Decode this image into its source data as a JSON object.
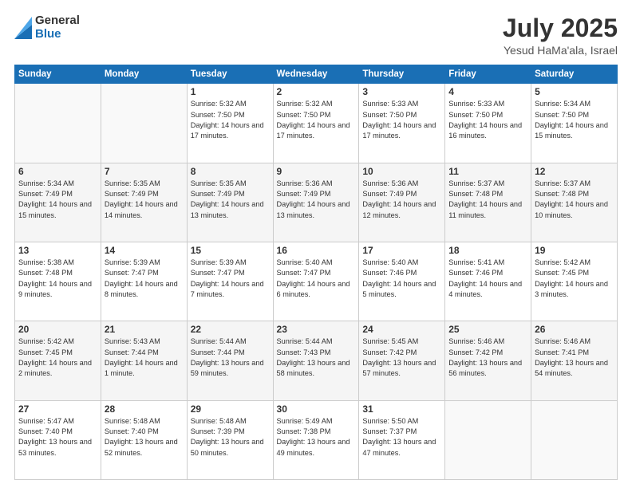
{
  "header": {
    "logo_general": "General",
    "logo_blue": "Blue",
    "title": "July 2025",
    "location": "Yesud HaMa'ala, Israel"
  },
  "weekdays": [
    "Sunday",
    "Monday",
    "Tuesday",
    "Wednesday",
    "Thursday",
    "Friday",
    "Saturday"
  ],
  "weeks": [
    [
      {
        "day": "",
        "sunrise": "",
        "sunset": "",
        "daylight": ""
      },
      {
        "day": "",
        "sunrise": "",
        "sunset": "",
        "daylight": ""
      },
      {
        "day": "1",
        "sunrise": "Sunrise: 5:32 AM",
        "sunset": "Sunset: 7:50 PM",
        "daylight": "Daylight: 14 hours and 17 minutes."
      },
      {
        "day": "2",
        "sunrise": "Sunrise: 5:32 AM",
        "sunset": "Sunset: 7:50 PM",
        "daylight": "Daylight: 14 hours and 17 minutes."
      },
      {
        "day": "3",
        "sunrise": "Sunrise: 5:33 AM",
        "sunset": "Sunset: 7:50 PM",
        "daylight": "Daylight: 14 hours and 17 minutes."
      },
      {
        "day": "4",
        "sunrise": "Sunrise: 5:33 AM",
        "sunset": "Sunset: 7:50 PM",
        "daylight": "Daylight: 14 hours and 16 minutes."
      },
      {
        "day": "5",
        "sunrise": "Sunrise: 5:34 AM",
        "sunset": "Sunset: 7:50 PM",
        "daylight": "Daylight: 14 hours and 15 minutes."
      }
    ],
    [
      {
        "day": "6",
        "sunrise": "Sunrise: 5:34 AM",
        "sunset": "Sunset: 7:49 PM",
        "daylight": "Daylight: 14 hours and 15 minutes."
      },
      {
        "day": "7",
        "sunrise": "Sunrise: 5:35 AM",
        "sunset": "Sunset: 7:49 PM",
        "daylight": "Daylight: 14 hours and 14 minutes."
      },
      {
        "day": "8",
        "sunrise": "Sunrise: 5:35 AM",
        "sunset": "Sunset: 7:49 PM",
        "daylight": "Daylight: 14 hours and 13 minutes."
      },
      {
        "day": "9",
        "sunrise": "Sunrise: 5:36 AM",
        "sunset": "Sunset: 7:49 PM",
        "daylight": "Daylight: 14 hours and 13 minutes."
      },
      {
        "day": "10",
        "sunrise": "Sunrise: 5:36 AM",
        "sunset": "Sunset: 7:49 PM",
        "daylight": "Daylight: 14 hours and 12 minutes."
      },
      {
        "day": "11",
        "sunrise": "Sunrise: 5:37 AM",
        "sunset": "Sunset: 7:48 PM",
        "daylight": "Daylight: 14 hours and 11 minutes."
      },
      {
        "day": "12",
        "sunrise": "Sunrise: 5:37 AM",
        "sunset": "Sunset: 7:48 PM",
        "daylight": "Daylight: 14 hours and 10 minutes."
      }
    ],
    [
      {
        "day": "13",
        "sunrise": "Sunrise: 5:38 AM",
        "sunset": "Sunset: 7:48 PM",
        "daylight": "Daylight: 14 hours and 9 minutes."
      },
      {
        "day": "14",
        "sunrise": "Sunrise: 5:39 AM",
        "sunset": "Sunset: 7:47 PM",
        "daylight": "Daylight: 14 hours and 8 minutes."
      },
      {
        "day": "15",
        "sunrise": "Sunrise: 5:39 AM",
        "sunset": "Sunset: 7:47 PM",
        "daylight": "Daylight: 14 hours and 7 minutes."
      },
      {
        "day": "16",
        "sunrise": "Sunrise: 5:40 AM",
        "sunset": "Sunset: 7:47 PM",
        "daylight": "Daylight: 14 hours and 6 minutes."
      },
      {
        "day": "17",
        "sunrise": "Sunrise: 5:40 AM",
        "sunset": "Sunset: 7:46 PM",
        "daylight": "Daylight: 14 hours and 5 minutes."
      },
      {
        "day": "18",
        "sunrise": "Sunrise: 5:41 AM",
        "sunset": "Sunset: 7:46 PM",
        "daylight": "Daylight: 14 hours and 4 minutes."
      },
      {
        "day": "19",
        "sunrise": "Sunrise: 5:42 AM",
        "sunset": "Sunset: 7:45 PM",
        "daylight": "Daylight: 14 hours and 3 minutes."
      }
    ],
    [
      {
        "day": "20",
        "sunrise": "Sunrise: 5:42 AM",
        "sunset": "Sunset: 7:45 PM",
        "daylight": "Daylight: 14 hours and 2 minutes."
      },
      {
        "day": "21",
        "sunrise": "Sunrise: 5:43 AM",
        "sunset": "Sunset: 7:44 PM",
        "daylight": "Daylight: 14 hours and 1 minute."
      },
      {
        "day": "22",
        "sunrise": "Sunrise: 5:44 AM",
        "sunset": "Sunset: 7:44 PM",
        "daylight": "Daylight: 13 hours and 59 minutes."
      },
      {
        "day": "23",
        "sunrise": "Sunrise: 5:44 AM",
        "sunset": "Sunset: 7:43 PM",
        "daylight": "Daylight: 13 hours and 58 minutes."
      },
      {
        "day": "24",
        "sunrise": "Sunrise: 5:45 AM",
        "sunset": "Sunset: 7:42 PM",
        "daylight": "Daylight: 13 hours and 57 minutes."
      },
      {
        "day": "25",
        "sunrise": "Sunrise: 5:46 AM",
        "sunset": "Sunset: 7:42 PM",
        "daylight": "Daylight: 13 hours and 56 minutes."
      },
      {
        "day": "26",
        "sunrise": "Sunrise: 5:46 AM",
        "sunset": "Sunset: 7:41 PM",
        "daylight": "Daylight: 13 hours and 54 minutes."
      }
    ],
    [
      {
        "day": "27",
        "sunrise": "Sunrise: 5:47 AM",
        "sunset": "Sunset: 7:40 PM",
        "daylight": "Daylight: 13 hours and 53 minutes."
      },
      {
        "day": "28",
        "sunrise": "Sunrise: 5:48 AM",
        "sunset": "Sunset: 7:40 PM",
        "daylight": "Daylight: 13 hours and 52 minutes."
      },
      {
        "day": "29",
        "sunrise": "Sunrise: 5:48 AM",
        "sunset": "Sunset: 7:39 PM",
        "daylight": "Daylight: 13 hours and 50 minutes."
      },
      {
        "day": "30",
        "sunrise": "Sunrise: 5:49 AM",
        "sunset": "Sunset: 7:38 PM",
        "daylight": "Daylight: 13 hours and 49 minutes."
      },
      {
        "day": "31",
        "sunrise": "Sunrise: 5:50 AM",
        "sunset": "Sunset: 7:37 PM",
        "daylight": "Daylight: 13 hours and 47 minutes."
      },
      {
        "day": "",
        "sunrise": "",
        "sunset": "",
        "daylight": ""
      },
      {
        "day": "",
        "sunrise": "",
        "sunset": "",
        "daylight": ""
      }
    ]
  ]
}
